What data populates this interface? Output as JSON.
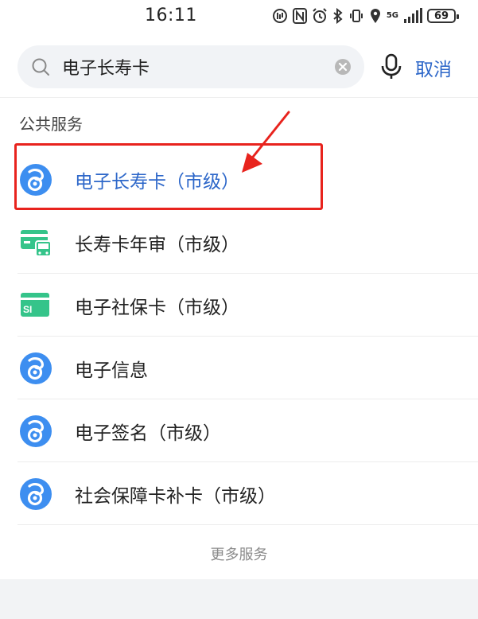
{
  "status_bar": {
    "time": "16:11",
    "network_label": "5G",
    "battery": "69"
  },
  "search": {
    "query": "电子长寿卡",
    "cancel_label": "取消"
  },
  "section": {
    "title": "公共服务"
  },
  "items": [
    {
      "label": "电子长寿卡（市级）",
      "icon": "swirl-logo-icon",
      "highlighted": true
    },
    {
      "label": "长寿卡年审（市级）",
      "icon": "bus-card-icon"
    },
    {
      "label": "电子社保卡（市级）",
      "icon": "si-card-icon"
    },
    {
      "label": "电子信息",
      "icon": "swirl-logo-icon"
    },
    {
      "label": "电子签名（市级）",
      "icon": "swirl-logo-icon"
    },
    {
      "label": "社会保障卡补卡（市级）",
      "icon": "swirl-logo-icon"
    }
  ],
  "more_label": "更多服务",
  "colors": {
    "accent": "#2d67c9",
    "annotation": "#e8231d",
    "logo_blue": "#3d8ef0",
    "card_green": "#35c48a"
  }
}
